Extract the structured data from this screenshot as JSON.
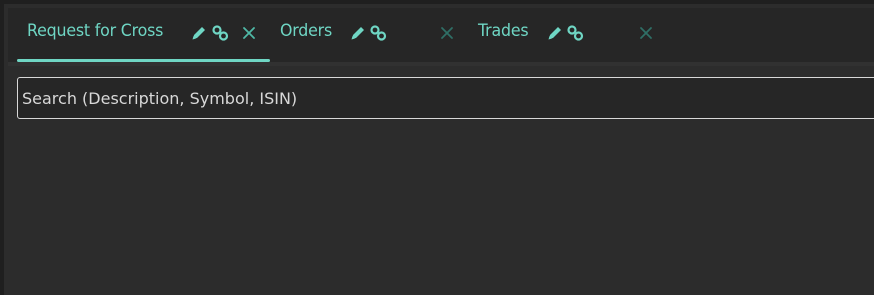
{
  "tabs": [
    {
      "label": "Request for Cross",
      "active": true
    },
    {
      "label": "Orders",
      "active": false
    },
    {
      "label": "Trades",
      "active": false
    }
  ],
  "icons": {
    "edit": "pencil-icon",
    "link": "link-icon",
    "close": "close-icon"
  },
  "search": {
    "placeholder": "Search (Description, Symbol, ISIN)",
    "value": ""
  },
  "colors": {
    "accent": "#6fd6c4",
    "close_active": "#4fb8a6",
    "close_inactive": "#2f6f66",
    "background": "#2c2c2c",
    "tabbar": "#262626"
  }
}
